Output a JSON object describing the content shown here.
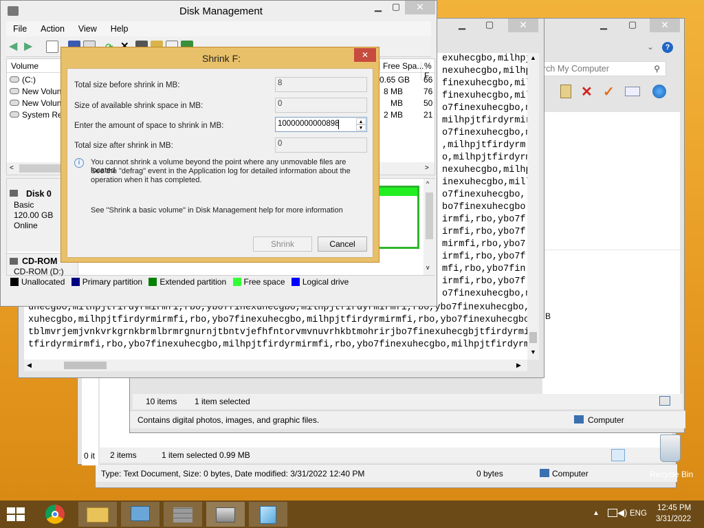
{
  "disk_mgmt": {
    "title": "Disk Management",
    "menu": [
      "File",
      "Action",
      "View",
      "Help"
    ],
    "columns": {
      "volume": "Volume",
      "free_space": "Free Spa...",
      "percent": "% F"
    },
    "volumes": [
      {
        "name": "(C:)",
        "free": "0.65 GB",
        "pct": "66"
      },
      {
        "name": "New Volun",
        "free": "8 MB",
        "pct": "76"
      },
      {
        "name": "New Volun",
        "free": "MB",
        "pct": "50"
      },
      {
        "name": "System Res",
        "free": "2 MB",
        "pct": "21"
      }
    ],
    "disk0": {
      "label": "Disk 0",
      "type": "Basic",
      "size": "120.00 GB",
      "status": "Online"
    },
    "cdrom": {
      "label": "CD-ROM",
      "name": "CD-ROM (D:)"
    },
    "legend": [
      {
        "label": "Unallocated",
        "color": "#000000"
      },
      {
        "label": "Primary partition",
        "color": "#000080"
      },
      {
        "label": "Extended partition",
        "color": "#008000"
      },
      {
        "label": "Free space",
        "color": "#33ff33"
      },
      {
        "label": "Logical drive",
        "color": "#0000ff"
      }
    ]
  },
  "dialog": {
    "title": "Shrink F:",
    "close": "✕",
    "total_before_label": "Total size before shrink in MB:",
    "total_before_value": "8",
    "available_label": "Size of available shrink space in MB:",
    "available_value": "0",
    "amount_label": "Enter the amount of space to shrink in MB:",
    "amount_value": "10000000000898",
    "total_after_label": "Total size after shrink in MB:",
    "total_after_value": "0",
    "info_text_1": "You cannot shrink a volume beyond the point where any unmovable files are located.",
    "info_text_2": "See the \"defrag\" event in the Application log for detailed information about the",
    "info_text_3": "operation when it has completed.",
    "help_text": "See \"Shrink a basic volume\" in Disk Management help for more information",
    "shrink_button": "Shrink",
    "cancel_button": "Cancel"
  },
  "notepad": {
    "right_lines": [
      "exuhecgbo,milhpj",
      "nexuhecgbo,milhp",
      "finexuhecgbo,mil",
      "finexuhecgbo,milh",
      "o7finexuhecgbo,m",
      "milhpjtfirdyrmir",
      "o7finexuhecgbo,m",
      ",milhpjtfirdyrm",
      "o,milhpjtfirdyrm",
      "nexuhecgbo,milhp",
      "inexuhecgbo,mill",
      "o7finexuhecgbo,",
      "bo7finexuhecgbo",
      "irmfi,rbo,ybo7f",
      "irmfi,rbo,ybo7f",
      "mirmfi,rbo,ybo7",
      "irmfi,rbo,ybo7f",
      "mfi,rbo,ybo7fin",
      "irmfi,rbo,ybo7f",
      "o7finexuhecgbo,m"
    ],
    "bottom_lines": [
      "uhecgbo,milhpjtfirdyrmirmfi,rbo,ybo7finexuhecgbo,milhpjtfirdyrmirmfi,rbo,ybo7finexuhecgbo,m",
      "xuhecgbo,milhpjtfirdyrmirmfi,rbo,ybo7finexuhecgbo,milhpjtfirdyrmirmfi,rbo,ybo7finexuhecgbo",
      "tblmvrjemjvnkvrkgrnkbrmlbrmrgnurnjtbntvjefhfntorvmvnuvrhkbtmohrirjbo7finexuhecgbjtfirdyrmir",
      "tfirdyrmirmfi,rbo,ybo7finexuhecgbo,milhpjtfirdyrmirmfi,rbo,ybo7finexuhecgbo,milhpjtfirdyrm"
    ]
  },
  "explorer_front": {
    "search_placeholder": "rch My Computer",
    "items_count": "10 items",
    "selected": "1 item selected",
    "description": "Contains digital photos, images, and graphic files.",
    "location": "Computer",
    "stray_b": "B"
  },
  "explorer_back": {
    "items_count": "2 items",
    "selected": "1 item selected  0.99 MB",
    "details": "Type: Text Document, Size: 0 bytes, Date modified: 3/31/2022 12:40 PM",
    "size": "0 bytes",
    "location": "Computer",
    "left_fragment": "0 it"
  },
  "desktop": {
    "recycle_bin": "Recycle Bin"
  },
  "taskbar": {
    "language": "ENG",
    "time": "12:45 PM",
    "date": "3/31/2022",
    "apps": [
      "start",
      "chrome",
      "file-explorer",
      "control-panel",
      "firewall",
      "disk-management",
      "notepad"
    ]
  }
}
